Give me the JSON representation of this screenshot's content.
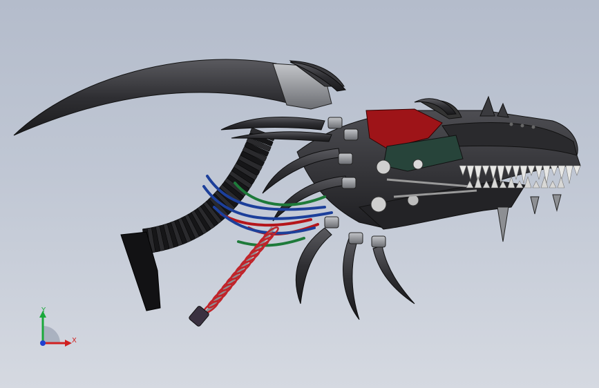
{
  "viewport": {
    "description_free": true,
    "background_top": "#b4bccb",
    "background_bottom": "#d5d9e1"
  },
  "model": {
    "colors": {
      "body": "#2b2b2e",
      "body_light": "#4a4a4f",
      "accent_red": "#9e1418",
      "metal": "#8d8f93",
      "wire_blue": "#1c3f9a",
      "wire_green": "#1e7a3a",
      "wire_red": "#b5161b",
      "spring": "#c0242a",
      "teeth": "#e8e8e6",
      "gear": "#cfcfcf"
    }
  },
  "triad": {
    "y_label": "Y",
    "x_label": "X",
    "y_color": "#1aa83a",
    "x_color": "#d02020",
    "z_color": "#1f3fd0",
    "icon": "coordinate-triad-icon"
  }
}
